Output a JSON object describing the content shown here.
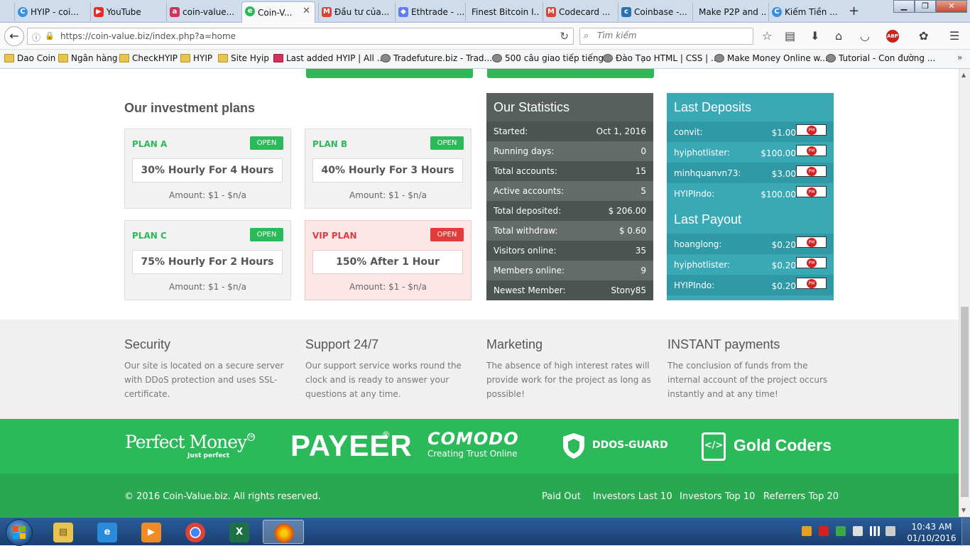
{
  "browser": {
    "tabs": [
      {
        "label": "HYIP - coi...",
        "icon": "hyip-icon",
        "color": "#3b8fe0"
      },
      {
        "label": "YouTube",
        "icon": "youtube-icon",
        "color": "#e52d27"
      },
      {
        "label": "coin-value...",
        "icon": "coin-value-icon",
        "color": "#d5305a"
      },
      {
        "label": "Coin-V...",
        "icon": "coin-v-icon",
        "color": "#2bb95a",
        "active": true
      },
      {
        "label": "Đầu tư của...",
        "icon": "gmail-icon",
        "color": "#d44638"
      },
      {
        "label": "Ethtrade - ...",
        "icon": "ethereum-icon",
        "color": "#627eea"
      },
      {
        "label": "Finest Bitcoin I...",
        "icon": "",
        "color": ""
      },
      {
        "label": "Codecard ...",
        "icon": "gmail-icon",
        "color": "#d44638"
      },
      {
        "label": "Coinbase -...",
        "icon": "coinbase-icon",
        "color": "#2b71b1"
      },
      {
        "label": "Make P2P and ...",
        "icon": "",
        "color": ""
      },
      {
        "label": "Kiếm Tiền ...",
        "icon": "kiem-tien-icon",
        "color": "#3b8fe0"
      }
    ],
    "url": "https://coin-value.biz/index.php?a=home",
    "search_placeholder": "Tìm kiếm",
    "bookmarks": [
      {
        "label": "Dao Coin",
        "icon": "folder"
      },
      {
        "label": "Ngân hàng",
        "icon": "folder"
      },
      {
        "label": "CheckHYIP",
        "icon": "folder"
      },
      {
        "label": "HYIP",
        "icon": "folder"
      },
      {
        "label": "Site Hyip",
        "icon": "folder"
      },
      {
        "label": "Last added HYIP | All ...",
        "icon": "red"
      },
      {
        "label": "Tradefuture.biz - Trad...",
        "icon": "web"
      },
      {
        "label": "500 câu giao tiếp tiếng...",
        "icon": "web"
      },
      {
        "label": "Đào Tạo HTML | CSS | ...",
        "icon": "web"
      },
      {
        "label": "Make Money Online w...",
        "icon": "web"
      },
      {
        "label": "Tutorial - Con đường ...",
        "icon": "web"
      }
    ],
    "abp_label": "ABP"
  },
  "plans": {
    "title": "Our investment plans",
    "items": [
      {
        "name": "PLAN A",
        "status": "OPEN",
        "rate": "30% Hourly For 4 Hours",
        "amount": "Amount: $1 - $n/a",
        "vip": false
      },
      {
        "name": "PLAN B",
        "status": "OPEN",
        "rate": "40% Hourly For 3 Hours",
        "amount": "Amount: $1 - $n/a",
        "vip": false
      },
      {
        "name": "PLAN C",
        "status": "OPEN",
        "rate": "75% Hourly For 2 Hours",
        "amount": "Amount: $1 - $n/a",
        "vip": false
      },
      {
        "name": "VIP PLAN",
        "status": "OPEN",
        "rate": "150% After 1 Hour",
        "amount": "Amount: $1 - $n/a",
        "vip": true
      }
    ]
  },
  "statistics": {
    "title": "Our Statistics",
    "rows": [
      {
        "key": "Started:",
        "value": "Oct 1, 2016"
      },
      {
        "key": "Running days:",
        "value": "0"
      },
      {
        "key": "Total accounts:",
        "value": "15"
      },
      {
        "key": "Active accounts:",
        "value": "5"
      },
      {
        "key": "Total deposited:",
        "value": "$ 206.00"
      },
      {
        "key": "Total withdraw:",
        "value": "$ 0.60"
      },
      {
        "key": "Visitors online:",
        "value": "35"
      },
      {
        "key": "Members online:",
        "value": "9"
      },
      {
        "key": "Newest Member:",
        "value": "Stony85"
      }
    ]
  },
  "deposits": {
    "title": "Last Deposits",
    "rows": [
      {
        "user": "convit:",
        "amount": "$1.00"
      },
      {
        "user": "hyiphotlister:",
        "amount": "$100.00"
      },
      {
        "user": "minhquanvn73:",
        "amount": "$3.00"
      },
      {
        "user": "HYIPIndo:",
        "amount": "$100.00"
      }
    ],
    "payout_title": "Last Payout",
    "payouts": [
      {
        "user": "hoanglong:",
        "amount": "$0.20"
      },
      {
        "user": "hyiphotlister:",
        "amount": "$0.20"
      },
      {
        "user": "HYIPIndo:",
        "amount": "$0.20"
      }
    ],
    "pm_label": "PM"
  },
  "features": [
    {
      "title": "Security",
      "text": "Our site is located on a secure server with DDoS protection and uses SSL-certificate."
    },
    {
      "title": "Support 24/7",
      "text": "Our support service works round the clock and is ready to answer your questions at any time."
    },
    {
      "title": "Marketing",
      "text": "The absence of high interest rates will provide work for the project as long as possible!"
    },
    {
      "title": "INSTANT payments",
      "text": "The conclusion of funds from the internal account of the project occurs instantly and at any time!"
    }
  ],
  "logos": {
    "perfect_money": "Perfect Money",
    "perfect_money_sub": "Just perfect",
    "payeer": "PAYEER",
    "comodo": "COMODO",
    "comodo_sub": "Creating Trust Online",
    "ddos_guard": "DDOS-GUARD",
    "gold_coders": "Gold Coders"
  },
  "footer": {
    "copyright": "© 2016 Coin-Value.biz. All rights reserved.",
    "links": [
      "Paid Out",
      "Investors Last 10",
      "Investors Top 10",
      "Referrers Top 20"
    ]
  },
  "taskbar": {
    "time": "10:43 AM",
    "date": "01/10/2016"
  },
  "colors": {
    "brand_green": "#2bb95a",
    "vip_red": "#e23b3b",
    "stats_gray": "#58605e",
    "deposits_teal": "#3aa9b6"
  }
}
